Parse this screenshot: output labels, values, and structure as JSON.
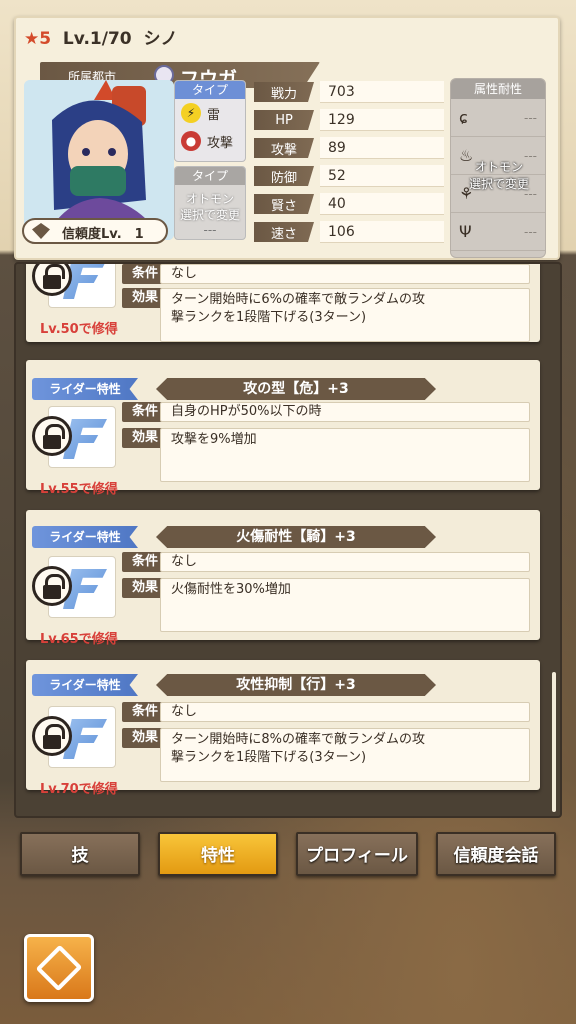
{
  "header": {
    "rarity": "★5",
    "level": "Lv.1/70",
    "monster_name": "シノ",
    "city_label": "所属都市",
    "city_name": "フウガ",
    "trust": "信頼度Lv.　1"
  },
  "type_panel": {
    "title": "タイプ",
    "element": "雷",
    "attack_type": "攻撃",
    "otomon_title": "タイプ",
    "otomon_note_1": "オトモン",
    "otomon_note_2": "選択で変更",
    "otomon_dash": "---"
  },
  "stats": [
    {
      "label": "戦力",
      "value": "703"
    },
    {
      "label": "HP",
      "value": "129"
    },
    {
      "label": "攻撃",
      "value": "89"
    },
    {
      "label": "防御",
      "value": "52"
    },
    {
      "label": "賢さ",
      "value": "40"
    },
    {
      "label": "速さ",
      "value": "106"
    }
  ],
  "resistance": {
    "title": "属性耐性",
    "note_1": "オトモン",
    "note_2": "選択で変更",
    "dash": "---"
  },
  "skills": [
    {
      "cond_label": "条件",
      "cond": "なし",
      "effect_label": "効果",
      "effect_1": "ターン開始時に6%の確率で敵ランダムの攻",
      "effect_2": "撃ランクを1段階下げる(3ターン)",
      "learn": "Lv.50で修得"
    },
    {
      "category": "ライダー特性",
      "title": "攻の型【危】+3",
      "cond_label": "条件",
      "cond": "自身のHPが50%以下の時",
      "effect_label": "効果",
      "effect_1": "攻撃を9%増加",
      "effect_2": "",
      "learn": "Lv.55で修得"
    },
    {
      "category": "ライダー特性",
      "title": "火傷耐性【騎】+3",
      "cond_label": "条件",
      "cond": "なし",
      "effect_label": "効果",
      "effect_1": "火傷耐性を30%増加",
      "effect_2": "",
      "learn": "Lv.65で修得"
    },
    {
      "category": "ライダー特性",
      "title": "攻性抑制【行】+3",
      "cond_label": "条件",
      "cond": "なし",
      "effect_label": "効果",
      "effect_1": "ターン開始時に8%の確率で敵ランダムの攻",
      "effect_2": "撃ランクを1段階下げる(3ターン)",
      "learn": "Lv.70で修得"
    }
  ],
  "tabs": [
    {
      "label": "技",
      "active": false
    },
    {
      "label": "特性",
      "active": true
    },
    {
      "label": "プロフィール",
      "active": false
    },
    {
      "label": "信頼度会話",
      "active": false
    }
  ],
  "colors": {
    "accent": "#e39a12",
    "panel": "#6b5844",
    "rider": "#4f77c4",
    "learn": "#d8403a"
  },
  "icons": [
    "star-icon",
    "city-emblem-icon",
    "trust-icon",
    "lock-icon",
    "thunder-icon",
    "attack-icon",
    "back-icon"
  ]
}
